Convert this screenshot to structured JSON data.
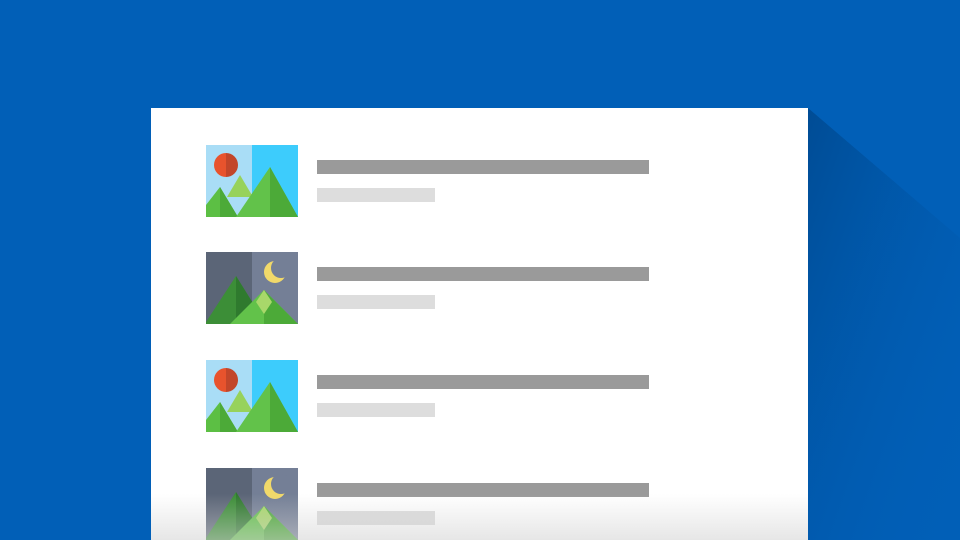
{
  "colors": {
    "background": "#015FB7",
    "card": "#FFFFFF",
    "title_placeholder": "#9A9A9A",
    "subtitle_placeholder": "#DDDDDD"
  },
  "list": {
    "items": [
      {
        "thumbnail_icon": "day-landscape-icon"
      },
      {
        "thumbnail_icon": "night-landscape-icon"
      },
      {
        "thumbnail_icon": "day-landscape-icon"
      },
      {
        "thumbnail_icon": "night-landscape-icon"
      }
    ]
  }
}
